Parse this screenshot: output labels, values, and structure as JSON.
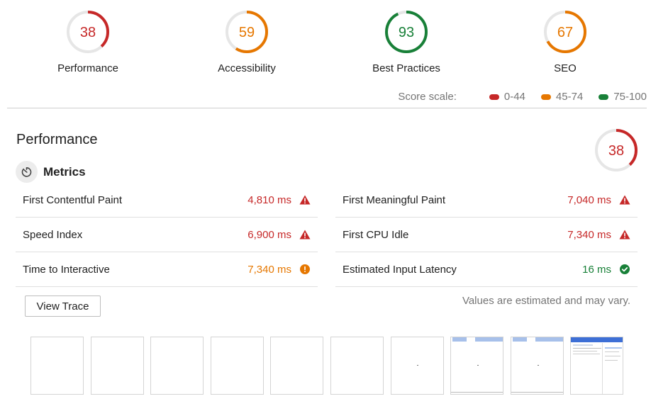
{
  "colors": {
    "fail": "#c62828",
    "average": "#e67700",
    "pass": "#188038",
    "track": "#e6e6e6"
  },
  "gauges": [
    {
      "score": "38",
      "label": "Performance",
      "status": "fail"
    },
    {
      "score": "59",
      "label": "Accessibility",
      "status": "average"
    },
    {
      "score": "93",
      "label": "Best Practices",
      "status": "pass"
    },
    {
      "score": "67",
      "label": "SEO",
      "status": "average"
    }
  ],
  "score_scale": {
    "label": "Score scale:",
    "ranges": [
      {
        "text": "0-44",
        "status": "fail"
      },
      {
        "text": "45-74",
        "status": "average"
      },
      {
        "text": "75-100",
        "status": "pass"
      }
    ]
  },
  "performance": {
    "title": "Performance",
    "score": "38",
    "metrics_title": "Metrics",
    "metrics_icon": "stopwatch-icon",
    "metrics_left": [
      {
        "name": "First Contentful Paint",
        "value": "4,810 ms",
        "status": "fail",
        "icon": "warning-triangle-icon"
      },
      {
        "name": "Speed Index",
        "value": "6,900 ms",
        "status": "fail",
        "icon": "warning-triangle-icon"
      },
      {
        "name": "Time to Interactive",
        "value": "7,340 ms",
        "status": "average",
        "icon": "info-circle-icon"
      }
    ],
    "metrics_right": [
      {
        "name": "First Meaningful Paint",
        "value": "7,040 ms",
        "status": "fail",
        "icon": "warning-triangle-icon"
      },
      {
        "name": "First CPU Idle",
        "value": "7,340 ms",
        "status": "fail",
        "icon": "warning-triangle-icon"
      },
      {
        "name": "Estimated Input Latency",
        "value": "16 ms",
        "status": "pass",
        "icon": "check-circle-icon"
      }
    ],
    "view_trace_label": "View Trace",
    "estimate_note": "Values are estimated and may vary."
  },
  "filmstrip": {
    "frames": [
      {
        "state": "blank"
      },
      {
        "state": "blank"
      },
      {
        "state": "blank"
      },
      {
        "state": "blank"
      },
      {
        "state": "blank"
      },
      {
        "state": "blank"
      },
      {
        "state": "speck"
      },
      {
        "state": "header"
      },
      {
        "state": "header"
      },
      {
        "state": "loaded"
      }
    ]
  }
}
